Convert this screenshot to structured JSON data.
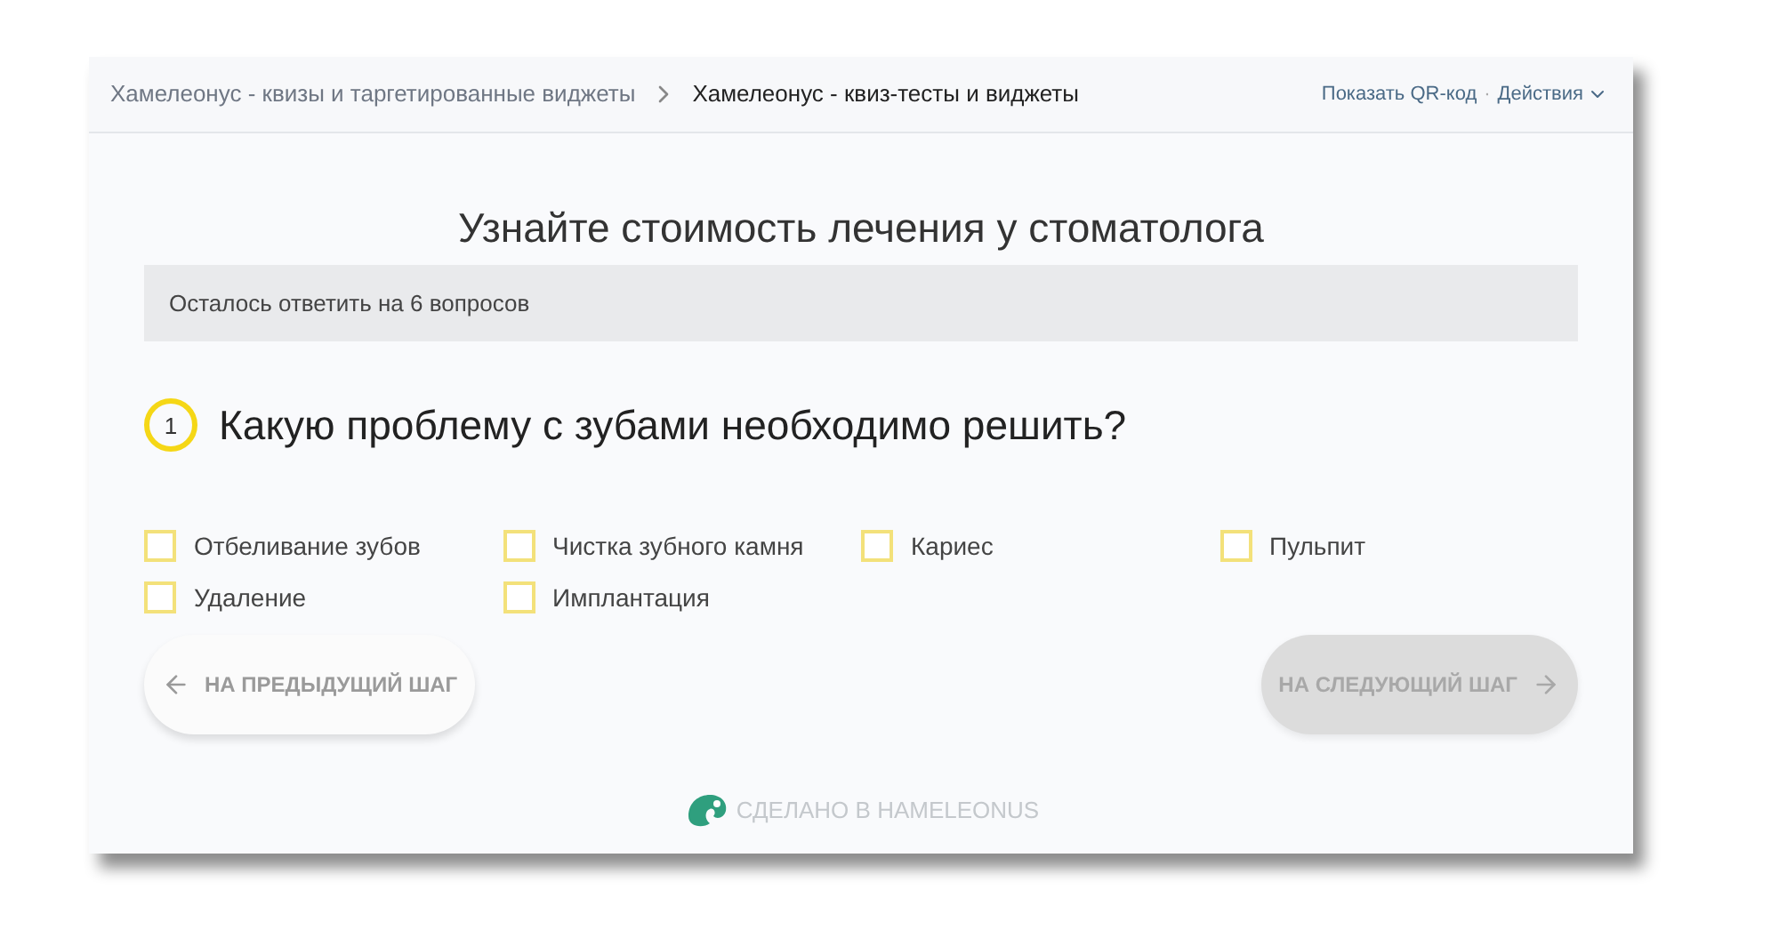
{
  "breadcrumbs": [
    {
      "label": "Хамелеонус - квизы и таргетированные виджеты",
      "current": false
    },
    {
      "label": "Хамелеонус - квиз-тесты и виджеты",
      "current": true
    }
  ],
  "header_actions": {
    "qr": "Показать QR-код",
    "separator": "·",
    "actions": "Действия"
  },
  "quiz": {
    "title": "Узнайте стоимость лечения у стоматолога",
    "progress_text": "Осталось ответить на 6 вопросов",
    "question_number": "1",
    "question": "Какую проблему с зубами необходимо решить?",
    "options": [
      {
        "label": "Отбеливание зубов",
        "checked": false
      },
      {
        "label": "Чистка зубного камня",
        "checked": false
      },
      {
        "label": "Кариес",
        "checked": false
      },
      {
        "label": "Пульпит",
        "checked": false
      },
      {
        "label": "Удаление",
        "checked": false
      },
      {
        "label": "Имплантация",
        "checked": false
      }
    ],
    "prev_button": {
      "label": "НА ПРЕДЫДУЩИЙ ШАГ",
      "disabled": false
    },
    "next_button": {
      "label": "НА СЛЕДУЮЩИЙ ШАГ",
      "disabled": true
    }
  },
  "footer": {
    "label": "СДЕЛАНО В HAMELEONUS"
  }
}
